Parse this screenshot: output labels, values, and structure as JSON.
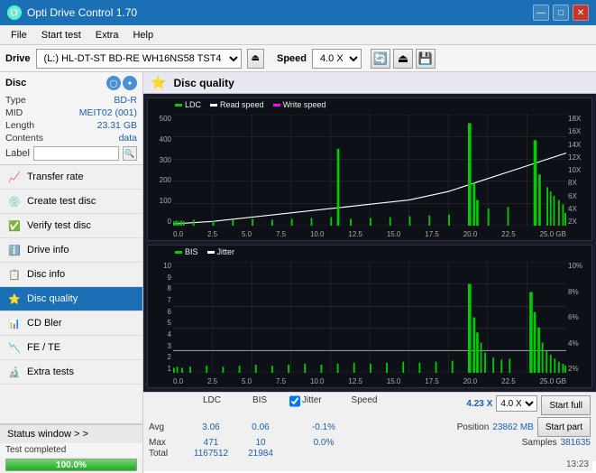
{
  "app": {
    "title": "Opti Drive Control 1.70",
    "icon": "💿"
  },
  "title_bar": {
    "title": "Opti Drive Control 1.70",
    "minimize": "—",
    "maximize": "□",
    "close": "✕"
  },
  "menu": {
    "items": [
      "File",
      "Start test",
      "Extra",
      "Help"
    ]
  },
  "drive_bar": {
    "label": "Drive",
    "drive_select": "(L:)  HL-DT-ST BD-RE  WH16NS58 TST4",
    "speed_label": "Speed",
    "speed_value": "4.0 X",
    "eject_icon": "⏏",
    "icon1": "🔄",
    "icon2": "💾"
  },
  "disc_panel": {
    "title": "Disc",
    "type_label": "Type",
    "type_val": "BD-R",
    "mid_label": "MID",
    "mid_val": "MEIT02 (001)",
    "length_label": "Length",
    "length_val": "23.31 GB",
    "contents_label": "Contents",
    "contents_val": "data",
    "label_label": "Label",
    "label_input": ""
  },
  "sidebar_nav": [
    {
      "id": "transfer-rate",
      "label": "Transfer rate",
      "icon": "📈",
      "active": false
    },
    {
      "id": "create-test-disc",
      "label": "Create test disc",
      "icon": "💿",
      "active": false
    },
    {
      "id": "verify-test-disc",
      "label": "Verify test disc",
      "icon": "✅",
      "active": false
    },
    {
      "id": "drive-info",
      "label": "Drive info",
      "icon": "ℹ️",
      "active": false
    },
    {
      "id": "disc-info",
      "label": "Disc info",
      "icon": "📋",
      "active": false
    },
    {
      "id": "disc-quality",
      "label": "Disc quality",
      "icon": "⭐",
      "active": true
    },
    {
      "id": "cd-bler",
      "label": "CD Bler",
      "icon": "📊",
      "active": false
    },
    {
      "id": "fe-te",
      "label": "FE / TE",
      "icon": "📉",
      "active": false
    },
    {
      "id": "extra-tests",
      "label": "Extra tests",
      "icon": "🔬",
      "active": false
    }
  ],
  "status": {
    "window_label": "Status window > >",
    "status_text": "Test completed",
    "progress": 100,
    "progress_text": "100.0%",
    "timestamp": "13:23"
  },
  "disc_quality": {
    "title": "Disc quality",
    "legend": {
      "ldc": "LDC",
      "read_speed": "Read speed",
      "write_speed": "Write speed",
      "bis": "BIS",
      "jitter": "Jitter"
    },
    "chart1": {
      "y_max": 500,
      "y_labels": [
        "500",
        "400",
        "300",
        "200",
        "100",
        "0"
      ],
      "y_right": [
        "18X",
        "16X",
        "14X",
        "12X",
        "10X",
        "8X",
        "6X",
        "4X",
        "2X"
      ],
      "x_labels": [
        "0.0",
        "2.5",
        "5.0",
        "7.5",
        "10.0",
        "12.5",
        "15.0",
        "17.5",
        "20.0",
        "22.5",
        "25.0 GB"
      ]
    },
    "chart2": {
      "y_labels": [
        "10",
        "9",
        "8",
        "7",
        "6",
        "5",
        "4",
        "3",
        "2",
        "1"
      ],
      "y_right": [
        "10%",
        "8%",
        "6%",
        "4%",
        "2%"
      ],
      "x_labels": [
        "0.0",
        "2.5",
        "5.0",
        "7.5",
        "10.0",
        "12.5",
        "15.0",
        "17.5",
        "20.0",
        "22.5",
        "25.0 GB"
      ]
    },
    "stats": {
      "columns": [
        "LDC",
        "BIS",
        "",
        "Jitter",
        "Speed",
        ""
      ],
      "avg_label": "Avg",
      "avg_ldc": "3.06",
      "avg_bis": "0.06",
      "avg_jitter": "-0.1%",
      "max_label": "Max",
      "max_ldc": "471",
      "max_bis": "10",
      "max_jitter": "0.0%",
      "total_label": "Total",
      "total_ldc": "1167512",
      "total_bis": "21984",
      "speed_label": "Speed",
      "speed_val": "4.23 X",
      "speed_select": "4.0 X",
      "position_label": "Position",
      "position_val": "23862 MB",
      "samples_label": "Samples",
      "samples_val": "381635",
      "jitter_checked": true
    },
    "buttons": {
      "start_full": "Start full",
      "start_part": "Start part"
    }
  }
}
